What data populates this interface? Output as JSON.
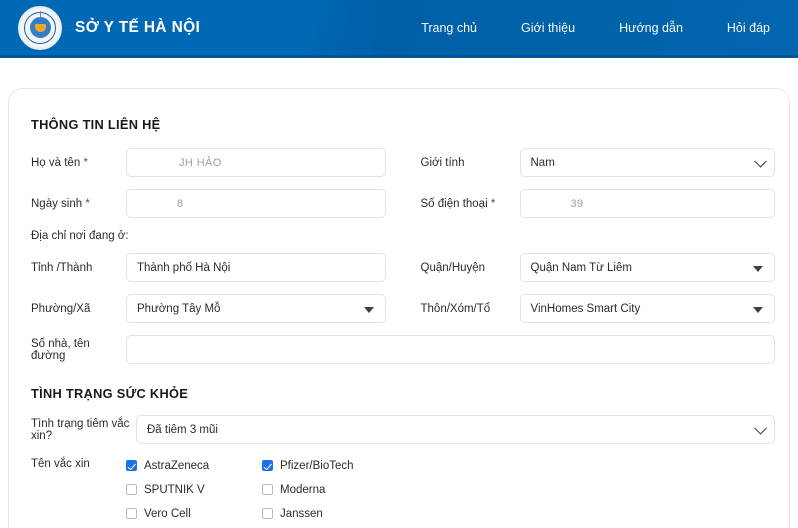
{
  "header": {
    "brand_title": "SỞ Y TẾ HÀ NỘI",
    "logo_name": "hanoi-health-department-emblem",
    "nav": [
      {
        "label": "Trang chủ"
      },
      {
        "label": "Giới thiệu"
      },
      {
        "label": "Hướng dẫn"
      },
      {
        "label": "Hỏi đáp"
      }
    ],
    "colors": {
      "background": "#0065b1",
      "border": "#02579b",
      "text": "#ffffff"
    }
  },
  "form": {
    "contact_section_title": "THÔNG TIN LIÊN HỆ",
    "health_section_title": "TÌNH TRẠNG SỨC KHỎE",
    "address_subheading": "Địa chỉ nơi đang ở:",
    "fields": {
      "fullname": {
        "label": "Họ và tên",
        "required": "*",
        "value": "JH HẢO"
      },
      "gender": {
        "label": "Giới tính",
        "value": "Nam"
      },
      "birthdate": {
        "label": "Ngày sinh",
        "required": "*",
        "value": "8"
      },
      "phone": {
        "label": "Số điện thoại",
        "required": "*",
        "value": "39"
      },
      "province": {
        "label": "Tỉnh /Thành",
        "value": "Thành phố Hà Nội"
      },
      "district": {
        "label": "Quận/Huyện",
        "value": "Quận Nam Từ Liêm"
      },
      "ward": {
        "label": "Phường/Xã",
        "value": "Phường Tây Mỗ"
      },
      "hamlet": {
        "label": "Thôn/Xóm/Tổ",
        "value": "VinHomes Smart City"
      },
      "street": {
        "label": "Số nhà, tên đường",
        "value": ""
      },
      "vaccine_status": {
        "label": "Tình trạng tiêm vắc xin?",
        "value": "Đã tiêm 3 mũi"
      },
      "vaccine_names": {
        "label": "Tên vắc xin"
      }
    },
    "vaccines": {
      "column1": [
        {
          "label": "AstraZeneca",
          "checked": true
        },
        {
          "label": "SPUTNIK V",
          "checked": false
        },
        {
          "label": "Vero Cell",
          "checked": false
        }
      ],
      "column2": [
        {
          "label": "Pfizer/BioTech",
          "checked": true
        },
        {
          "label": "Moderna",
          "checked": false
        },
        {
          "label": "Janssen",
          "checked": false
        }
      ]
    },
    "colors": {
      "checkbox_checked": "#1a73e8",
      "field_border": "#dfe3e8",
      "text": "#2b2b2b"
    }
  }
}
